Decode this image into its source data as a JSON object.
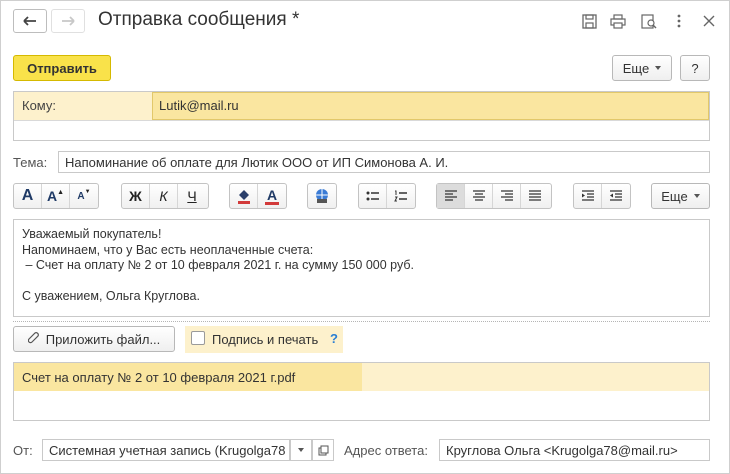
{
  "window": {
    "title": "Отправка сообщения *"
  },
  "icons": {
    "back": "arrow-left-icon",
    "forward": "arrow-right-icon",
    "save": "floppy-disk-icon",
    "print": "printer-icon",
    "preview": "preview-search-icon",
    "more": "vertical-dots-icon",
    "close": "close-icon"
  },
  "toolbar": {
    "send_label": "Отправить",
    "more_label": "Еще",
    "help_label": "?"
  },
  "to": {
    "label": "Кому:",
    "value": "Lutik@mail.ru"
  },
  "subject": {
    "label": "Тема:",
    "value": "Напоминание об оплате для Лютик ООО от ИП Симонова А. И."
  },
  "format": {
    "font_big": "A",
    "font_grow": "A",
    "font_shrink": "A",
    "bold": "Ж",
    "italic": "К",
    "underline": "Ч",
    "font_color": "A",
    "more_label": "Еще"
  },
  "message": {
    "lines": [
      "Уважаемый покупатель!",
      "Напоминаем, что у Вас есть неоплаченные счета:",
      " – Счет на оплату № 2 от 10 февраля 2021 г. на сумму 150 000 руб.",
      "",
      "С уважением, Ольга Круглова."
    ]
  },
  "attach": {
    "attach_label": "Приложить файл...",
    "sign_label": "Подпись и печать",
    "sign_checked": false,
    "help": "?",
    "files": [
      "Счет на оплату № 2 от 10 февраля 2021 г.pdf"
    ]
  },
  "footer": {
    "from_label": "От:",
    "from_value": "Системная учетная запись (Krugolga78",
    "reply_label": "Адрес ответа:",
    "reply_value": "Круглова Ольга <Krugolga78@mail.ru>"
  },
  "colors": {
    "accent_yellow": "#f9e24a",
    "field_highlight": "#fae6a0",
    "row_highlight": "#fdf1cc"
  }
}
